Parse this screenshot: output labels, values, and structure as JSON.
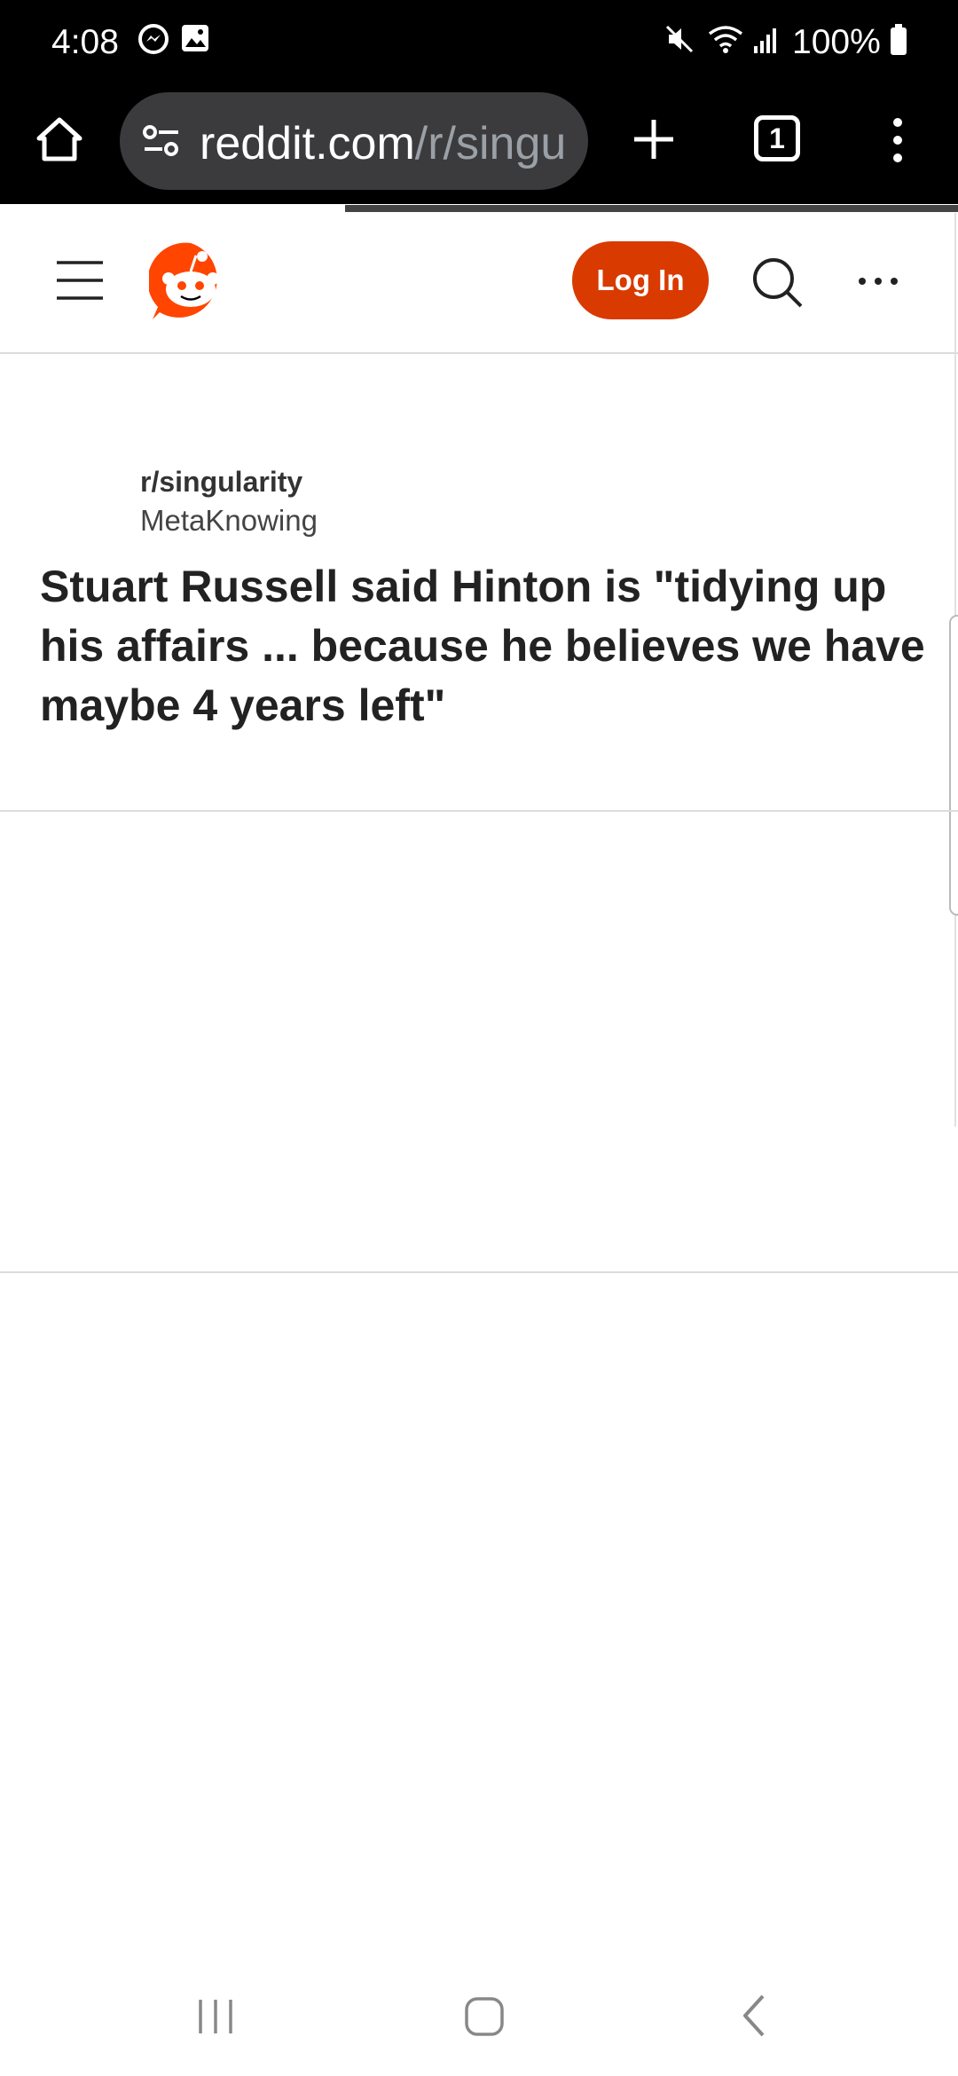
{
  "status_bar": {
    "time": "4:08",
    "battery": "100%",
    "left_icons": [
      "messenger-icon",
      "gallery-icon"
    ],
    "right_icons": [
      "mute-icon",
      "wifi-icon",
      "signal-icon",
      "battery-icon"
    ]
  },
  "browser": {
    "url_host": "reddit.com",
    "url_path": "/r/singul",
    "tab_count": "1",
    "load_progress": 0.36
  },
  "reddit_header": {
    "login_label": "Log In"
  },
  "post": {
    "subreddit": "r/singularity",
    "author": "MetaKnowing",
    "title": "Stuart Russell said Hinton is \"tidying up his affairs ... because he believes we have maybe 4 years left\""
  },
  "colors": {
    "reddit_orange": "#ff4500",
    "login_button": "#d93a00"
  }
}
